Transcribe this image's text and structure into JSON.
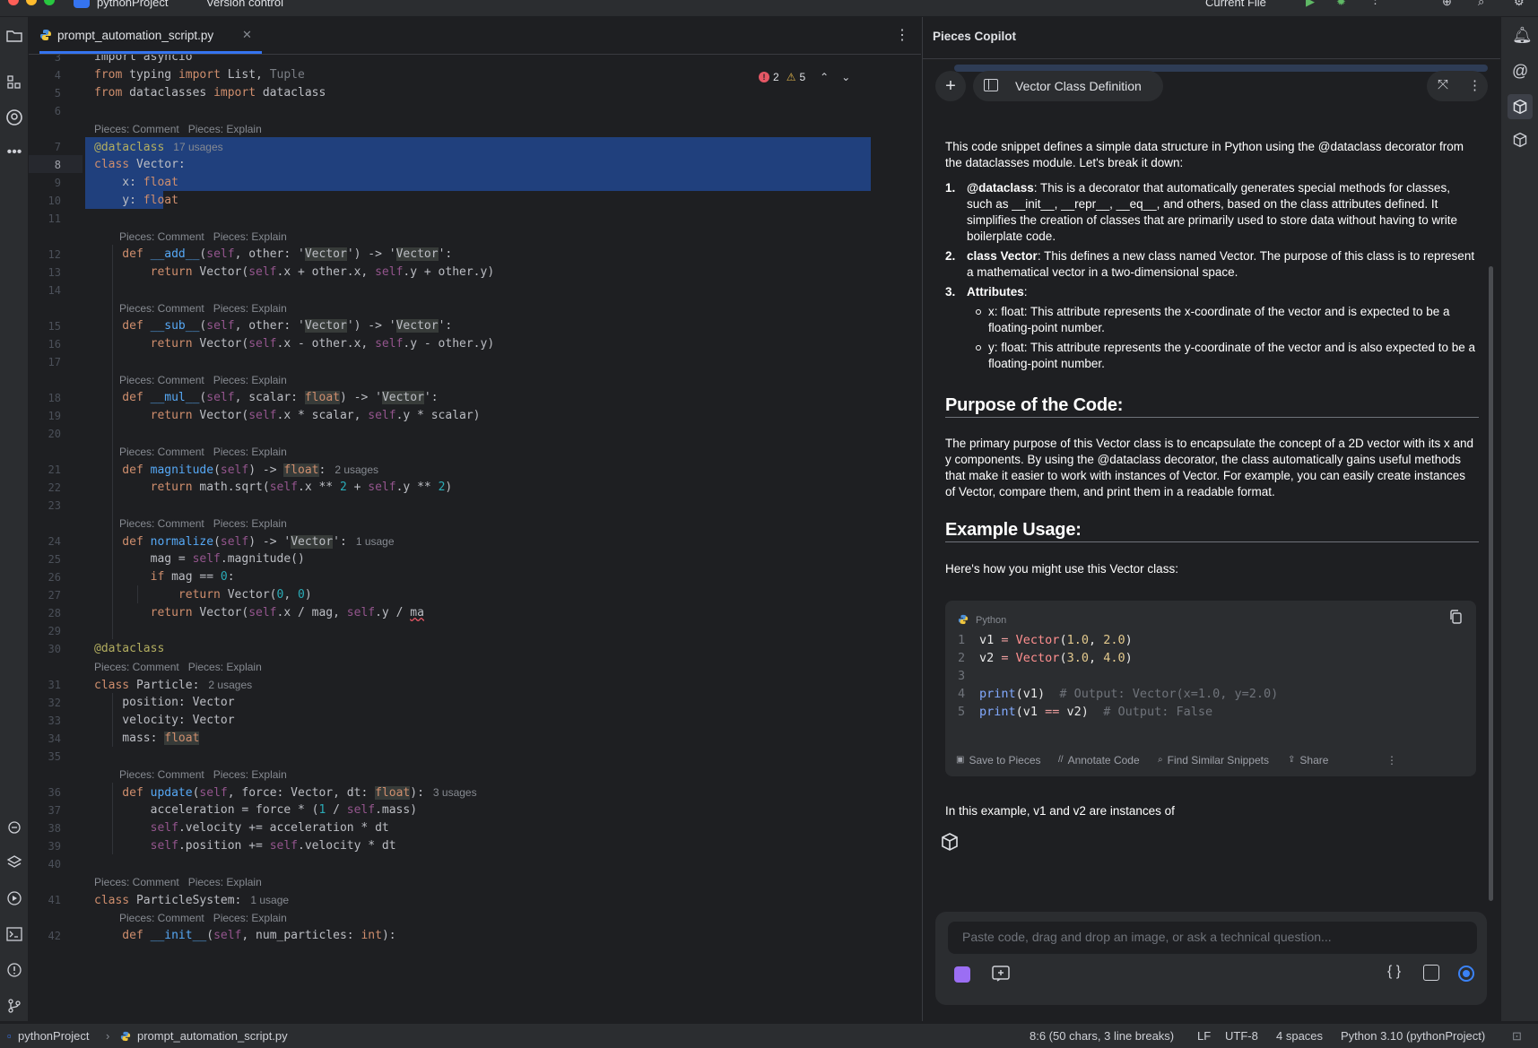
{
  "topbar": {
    "project": "pythonProject",
    "vcs": "Version control",
    "run_config": "Current File"
  },
  "editor": {
    "tab_name": "prompt_automation_script.py",
    "errors": "2",
    "warnings": "5",
    "hint_comment": "Pieces: Comment",
    "hint_explain": "Pieces: Explain"
  },
  "code_lines": [
    {
      "n": "3",
      "segs": [
        [
          "import asyncio",
          "kw0"
        ]
      ]
    },
    {
      "n": "4",
      "segs": [
        [
          "from ",
          "kw"
        ],
        [
          "typing ",
          ""
        ],
        [
          "import ",
          "kw"
        ],
        [
          "List, ",
          ""
        ],
        [
          "Tuple",
          "cm"
        ]
      ]
    },
    {
      "n": "5",
      "segs": [
        [
          "from ",
          "kw"
        ],
        [
          "dataclasses ",
          ""
        ],
        [
          "import ",
          "kw"
        ],
        [
          "dataclass",
          ""
        ]
      ]
    },
    {
      "n": "6",
      "segs": []
    },
    {
      "n": "7",
      "segs": [
        [
          "@dataclass",
          "dec"
        ]
      ],
      "usage": "17 usages"
    },
    {
      "n": "8",
      "segs": [
        [
          "class ",
          "kw"
        ],
        [
          "Vector:",
          ""
        ]
      ]
    },
    {
      "n": "9",
      "segs": [
        [
          "    x: ",
          ""
        ],
        [
          "float",
          "kw"
        ]
      ]
    },
    {
      "n": "10",
      "segs": [
        [
          "    y: ",
          ""
        ],
        [
          "float",
          "kw"
        ]
      ]
    },
    {
      "n": "11",
      "segs": []
    },
    {
      "n": "12",
      "segs": [
        [
          "    def ",
          "kw"
        ],
        [
          "__add__",
          "fn"
        ],
        [
          "(",
          ""
        ],
        [
          "self",
          "sf"
        ],
        [
          ", other: '",
          ""
        ],
        [
          "Vector",
          "tb"
        ],
        [
          "') -> '",
          ""
        ],
        [
          "Vector",
          "tb"
        ],
        [
          "':",
          ""
        ]
      ]
    },
    {
      "n": "13",
      "segs": [
        [
          "        return ",
          "kw"
        ],
        [
          "Vector(",
          ""
        ],
        [
          "self",
          "sf"
        ],
        [
          ".x + other.x, ",
          ""
        ],
        [
          "self",
          "sf"
        ],
        [
          ".y + other.y)",
          ""
        ]
      ]
    },
    {
      "n": "14",
      "segs": []
    },
    {
      "n": "15",
      "segs": [
        [
          "    def ",
          "kw"
        ],
        [
          "__sub__",
          "fn"
        ],
        [
          "(",
          ""
        ],
        [
          "self",
          "sf"
        ],
        [
          ", other: '",
          ""
        ],
        [
          "Vector",
          "tb"
        ],
        [
          "') -> '",
          ""
        ],
        [
          "Vector",
          "tb"
        ],
        [
          "':",
          ""
        ]
      ]
    },
    {
      "n": "16",
      "segs": [
        [
          "        return ",
          "kw"
        ],
        [
          "Vector(",
          ""
        ],
        [
          "self",
          "sf"
        ],
        [
          ".x - other.x, ",
          ""
        ],
        [
          "self",
          "sf"
        ],
        [
          ".y - other.y)",
          ""
        ]
      ]
    },
    {
      "n": "17",
      "segs": []
    },
    {
      "n": "18",
      "segs": [
        [
          "    def ",
          "kw"
        ],
        [
          "__mul__",
          "fn"
        ],
        [
          "(",
          ""
        ],
        [
          "self",
          "sf"
        ],
        [
          ", scalar: ",
          ""
        ],
        [
          "float",
          "kwtb"
        ],
        [
          ") -> '",
          ""
        ],
        [
          "Vector",
          "tb"
        ],
        [
          "':",
          ""
        ]
      ]
    },
    {
      "n": "19",
      "segs": [
        [
          "        return ",
          "kw"
        ],
        [
          "Vector(",
          ""
        ],
        [
          "self",
          "sf"
        ],
        [
          ".x * scalar, ",
          ""
        ],
        [
          "self",
          "sf"
        ],
        [
          ".y * scalar)",
          ""
        ]
      ]
    },
    {
      "n": "20",
      "segs": []
    },
    {
      "n": "21",
      "segs": [
        [
          "    def ",
          "kw"
        ],
        [
          "magnitude",
          "fn"
        ],
        [
          "(",
          ""
        ],
        [
          "self",
          "sf"
        ],
        [
          ") -> ",
          ""
        ],
        [
          "float",
          "kwtb"
        ],
        [
          ":",
          ""
        ]
      ],
      "usage": "2 usages"
    },
    {
      "n": "22",
      "segs": [
        [
          "        return ",
          "kw"
        ],
        [
          "math.sqrt(",
          ""
        ],
        [
          "self",
          "sf"
        ],
        [
          ".x ** ",
          ""
        ],
        [
          "2",
          "num"
        ],
        [
          " + ",
          ""
        ],
        [
          "self",
          "sf"
        ],
        [
          ".y ** ",
          ""
        ],
        [
          "2",
          "num"
        ],
        [
          ")",
          ""
        ]
      ]
    },
    {
      "n": "23",
      "segs": []
    },
    {
      "n": "24",
      "segs": [
        [
          "    def ",
          "kw"
        ],
        [
          "normalize",
          "fn"
        ],
        [
          "(",
          ""
        ],
        [
          "self",
          "sf"
        ],
        [
          ") -> '",
          ""
        ],
        [
          "Vector",
          "tb"
        ],
        [
          "':",
          ""
        ]
      ],
      "usage": "1 usage"
    },
    {
      "n": "25",
      "segs": [
        [
          "        mag = ",
          ""
        ],
        [
          "self",
          "sf"
        ],
        [
          ".magnitude()",
          ""
        ]
      ]
    },
    {
      "n": "26",
      "segs": [
        [
          "        if ",
          "kw"
        ],
        [
          "mag == ",
          ""
        ],
        [
          "0",
          "num"
        ],
        [
          ":",
          ""
        ]
      ]
    },
    {
      "n": "27",
      "segs": [
        [
          "            return ",
          "kw"
        ],
        [
          "Vector(",
          ""
        ],
        [
          "0",
          "num"
        ],
        [
          ", ",
          ""
        ],
        [
          "0",
          "num"
        ],
        [
          ")",
          ""
        ]
      ]
    },
    {
      "n": "28",
      "segs": [
        [
          "        return ",
          "kw"
        ],
        [
          "Vector(",
          ""
        ],
        [
          "self",
          "sf"
        ],
        [
          ".x / mag, ",
          ""
        ],
        [
          "self",
          "sf"
        ],
        [
          ".y / ",
          ""
        ],
        [
          "ma",
          "err"
        ]
      ]
    },
    {
      "n": "29",
      "segs": []
    },
    {
      "n": "30",
      "segs": [
        [
          "@dataclass",
          "dec"
        ]
      ]
    },
    {
      "n": "31",
      "segs": [
        [
          "class ",
          "kw"
        ],
        [
          "Particle:",
          ""
        ]
      ],
      "usage": "2 usages"
    },
    {
      "n": "32",
      "segs": [
        [
          "    position: Vector",
          ""
        ]
      ]
    },
    {
      "n": "33",
      "segs": [
        [
          "    velocity: Vector",
          ""
        ]
      ]
    },
    {
      "n": "34",
      "segs": [
        [
          "    mass: ",
          ""
        ],
        [
          "float",
          "kwtb"
        ]
      ]
    },
    {
      "n": "35",
      "segs": []
    },
    {
      "n": "36",
      "segs": [
        [
          "    def ",
          "kw"
        ],
        [
          "update",
          "fn"
        ],
        [
          "(",
          ""
        ],
        [
          "self",
          "sf"
        ],
        [
          ", force: Vector, dt: ",
          ""
        ],
        [
          "float",
          "kwtb"
        ],
        [
          "):",
          ""
        ]
      ],
      "usage": "3 usages"
    },
    {
      "n": "37",
      "segs": [
        [
          "        acceleration = force * (",
          ""
        ],
        [
          "1",
          "num"
        ],
        [
          " / ",
          ""
        ],
        [
          "self",
          "sf"
        ],
        [
          ".mass)",
          ""
        ]
      ]
    },
    {
      "n": "38",
      "segs": [
        [
          "        ",
          ""
        ],
        [
          "self",
          "sf"
        ],
        [
          ".velocity += acceleration * dt",
          ""
        ]
      ]
    },
    {
      "n": "39",
      "segs": [
        [
          "        ",
          ""
        ],
        [
          "self",
          "sf"
        ],
        [
          ".position += ",
          ""
        ],
        [
          "self",
          "sf"
        ],
        [
          ".velocity * dt",
          ""
        ]
      ]
    },
    {
      "n": "40",
      "segs": []
    },
    {
      "n": "41",
      "segs": [
        [
          "class ",
          "kw"
        ],
        [
          "ParticleSystem:",
          ""
        ]
      ],
      "usage": "1 usage"
    },
    {
      "n": "42",
      "segs": [
        [
          "    def ",
          "kw"
        ],
        [
          "__init__",
          "fn"
        ],
        [
          "(",
          ""
        ],
        [
          "self",
          "sf"
        ],
        [
          ", num_particles: ",
          ""
        ],
        [
          "int",
          "kw"
        ],
        [
          "):",
          ""
        ]
      ]
    }
  ],
  "copilot": {
    "panel_title": "Pieces Copilot",
    "chat_title": "Vector Class Definition",
    "intro": "This code snippet defines a simple data structure in Python using the @dataclass decorator from the dataclasses module. Let's break it down:",
    "items": [
      {
        "num": "1.",
        "bold": "@dataclass",
        "text": ": This is a decorator that automatically generates special methods for classes, such as __init__, __repr__, __eq__, and others, based on the class attributes defined. It simplifies the creation of classes that are primarily used to store data without having to write boilerplate code."
      },
      {
        "num": "2.",
        "bold": "class Vector",
        "text": ": This defines a new class named Vector. The purpose of this class is to represent a mathematical vector in a two-dimensional space."
      },
      {
        "num": "3.",
        "bold": "Attributes",
        "text": ":"
      }
    ],
    "subitems": [
      "x: float: This attribute represents the x-coordinate of the vector and is expected to be a floating-point number.",
      "y: float: This attribute represents the y-coordinate of the vector and is also expected to be a floating-point number."
    ],
    "purpose_heading": "Purpose of the Code:",
    "purpose_text": "The primary purpose of this Vector class is to encapsulate the concept of a 2D vector with its x and y components. By using the @dataclass decorator, the class automatically gains useful methods that make it easier to work with instances of Vector. For example, you can easily create instances of Vector, compare them, and print them in a readable format.",
    "example_heading": "Example Usage:",
    "example_intro": "Here's how you might use this Vector class:",
    "code_lang": "Python",
    "snippet": [
      {
        "n": "1",
        "segs": [
          [
            "v1 ",
            ""
          ],
          [
            "= ",
            "op"
          ],
          [
            "Vector",
            "cls"
          ],
          [
            "(",
            ""
          ],
          [
            "1.0",
            "num"
          ],
          [
            ", ",
            ""
          ],
          [
            "2.0",
            "num"
          ],
          [
            ")",
            ""
          ]
        ]
      },
      {
        "n": "2",
        "segs": [
          [
            "v2 ",
            ""
          ],
          [
            "= ",
            "op"
          ],
          [
            "Vector",
            "cls"
          ],
          [
            "(",
            ""
          ],
          [
            "3.0",
            "num"
          ],
          [
            ", ",
            ""
          ],
          [
            "4.0",
            "num"
          ],
          [
            ")",
            ""
          ]
        ]
      },
      {
        "n": "3",
        "segs": []
      },
      {
        "n": "4",
        "segs": [
          [
            "print",
            "fnb"
          ],
          [
            "(v1)  ",
            ""
          ],
          [
            "# Output: Vector(x=1.0, y=2.0)",
            "cmt"
          ]
        ]
      },
      {
        "n": "5",
        "segs": [
          [
            "print",
            "fnb"
          ],
          [
            "(v1 ",
            ""
          ],
          [
            "== ",
            "op"
          ],
          [
            "v2)  ",
            ""
          ],
          [
            "# Output: False",
            "cmt"
          ]
        ]
      }
    ],
    "actions": [
      "Save to Pieces",
      "Annotate Code",
      "Find Similar Snippets",
      "Share"
    ],
    "closing": "In this example, v1 and v2 are instances of",
    "input_placeholder": "Paste code, drag and drop an image, or ask a technical question..."
  },
  "status": {
    "project": "pythonProject",
    "file": "prompt_automation_script.py",
    "position": "8:6 (50 chars, 3 line breaks)",
    "line_sep": "LF",
    "encoding": "UTF-8",
    "indent": "4 spaces",
    "interpreter": "Python 3.10 (pythonProject)"
  }
}
